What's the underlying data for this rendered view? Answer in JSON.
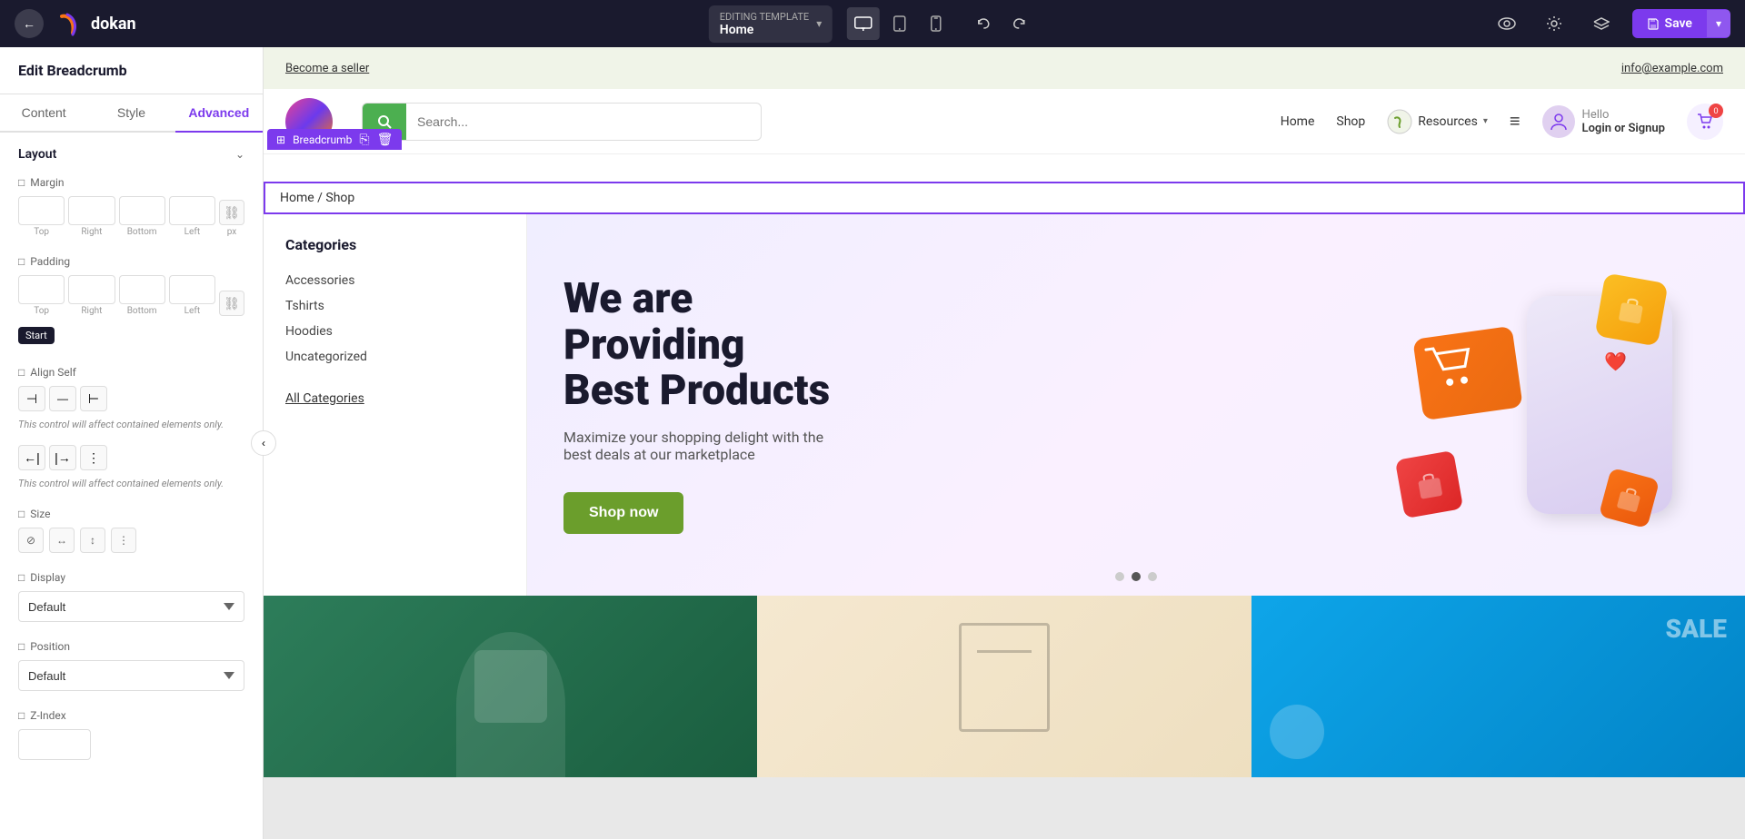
{
  "topbar": {
    "back_label": "←",
    "logo_text": "dokan",
    "template_label": "EDITING TEMPLATE",
    "template_name": "Home",
    "dropdown_icon": "▾",
    "device_desktop": "🖥",
    "device_tablet": "▣",
    "device_mobile": "📱",
    "undo_icon": "↩",
    "redo_icon": "↪",
    "eye_icon": "👁",
    "settings_icon": "⚙",
    "layers_icon": "⊞",
    "save_label": "Save",
    "save_arrow": "▾"
  },
  "left_panel": {
    "title": "Edit Breadcrumb",
    "tabs": [
      "Content",
      "Style",
      "Advanced"
    ],
    "active_tab": "Advanced",
    "layout_section": "Layout",
    "margin_label": "Margin",
    "margin_icon": "□",
    "margin_top": "",
    "margin_right": "",
    "margin_bottom": "",
    "margin_left": "",
    "margin_unit": "px",
    "input_labels": [
      "Top",
      "Right",
      "Bottom",
      "Left"
    ],
    "padding_label": "Padding",
    "padding_icon": "□",
    "padding_top": "",
    "padding_right": "",
    "padding_bottom": "",
    "padding_left": "",
    "tooltip_start": "Start",
    "align_self_label": "Align Self",
    "align_self_icon": "□",
    "align_hint": "This control will affect contained elements only.",
    "align_left_icon": "⊣",
    "align_center_icon": "⊥",
    "align_right_icon": "⊢",
    "order_label_1": "←|",
    "order_label_2": "|→",
    "order_label_3": "⋮",
    "size_label": "Size",
    "size_icon": "□",
    "size_btn1": "⊘",
    "size_btn2": "↔",
    "size_btn3": "↕",
    "size_btn4": "⋮",
    "display_label": "Display",
    "display_value": "Default",
    "position_label": "Position",
    "position_value": "Default",
    "zindex_label": "Z-Index",
    "zindex_icon": "□"
  },
  "preview": {
    "topbar_left_link": "Become a seller",
    "topbar_right_link": "info@example.com",
    "search_placeholder": "Search...",
    "nav_home": "Home",
    "nav_shop": "Shop",
    "nav_resources": "Resources",
    "breadcrumb_label": "Breadcrumb",
    "breadcrumb_copy_icon": "⎘",
    "breadcrumb_delete_icon": "🗑",
    "breadcrumb_path": "Home / Shop",
    "categories_title": "Categories",
    "categories": [
      "Accessories",
      "Tshirts",
      "Hoodies",
      "Uncategorized"
    ],
    "all_categories": "All Categories",
    "hero_heading_line1": "We are",
    "hero_heading_line2": "Providing",
    "hero_heading_line3": "Best Products",
    "hero_subtext": "Maximize your shopping delight with the best deals at our marketplace",
    "shop_now": "Shop now",
    "user_hello": "Hello",
    "user_login": "Login or Signup",
    "cart_count": "0"
  }
}
